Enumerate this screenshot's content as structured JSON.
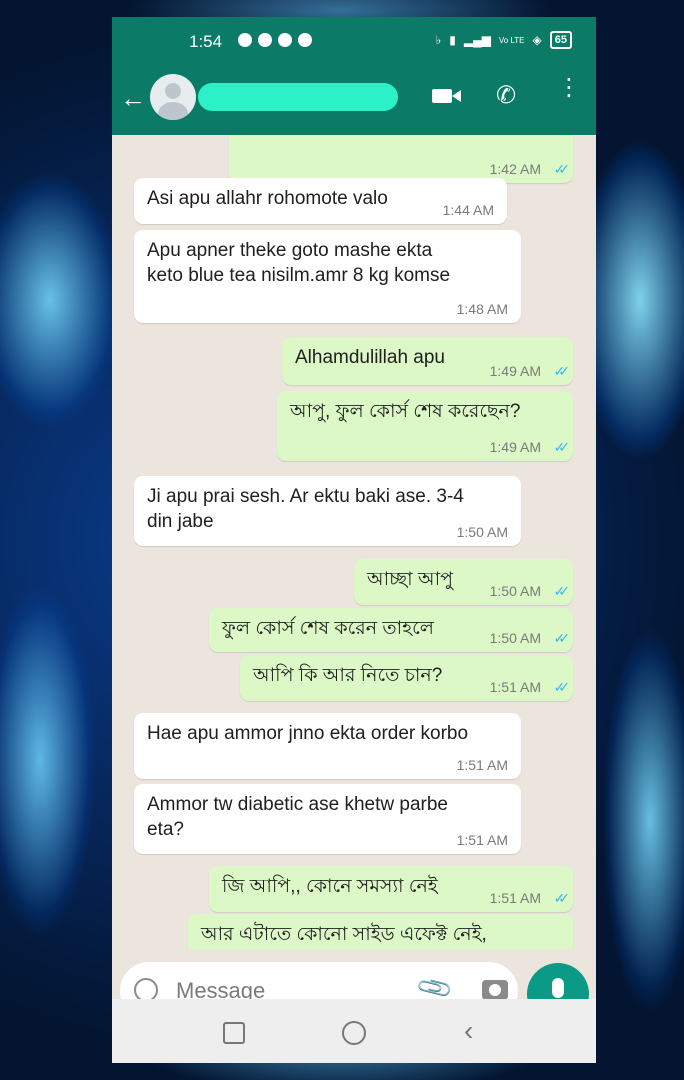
{
  "status_bar": {
    "time": "1:54",
    "battery": "65",
    "signal_text": "Vo LTE"
  },
  "header": {
    "contact_name": "Contact name (redacted)",
    "back_icon": "back-arrow-icon",
    "video_icon": "video-camera-icon",
    "call_icon": "phone-icon",
    "menu_icon": "more-vertical-icon"
  },
  "messages": [
    {
      "dir": "out",
      "text": "",
      "time": "1:42 AM"
    },
    {
      "dir": "in",
      "text": "Asi apu allahr rohomote valo",
      "time": "1:44 AM"
    },
    {
      "dir": "in",
      "text": "Apu apner theke goto mashe ekta\nketo blue tea nisilm.amr 8 kg komse",
      "time": "1:48 AM"
    },
    {
      "dir": "out",
      "text": "Alhamdulillah apu",
      "time": "1:49 AM"
    },
    {
      "dir": "out",
      "text": "আপু, ফুল কোর্স শেষ করেছেন?",
      "time": "1:49 AM"
    },
    {
      "dir": "in",
      "text": "Ji apu prai sesh. Ar ektu baki ase. 3-4\ndin jabe",
      "time": "1:50 AM"
    },
    {
      "dir": "out",
      "text": "আচ্ছা আপু",
      "time": "1:50 AM"
    },
    {
      "dir": "out",
      "text": "ফুল কোর্স শেষ করেন তাহলে",
      "time": "1:50 AM"
    },
    {
      "dir": "out",
      "text": "আপি কি আর নিতে চান?",
      "time": "1:51 AM"
    },
    {
      "dir": "in",
      "text": "Hae apu ammor jnno ekta order korbo",
      "time": "1:51 AM"
    },
    {
      "dir": "in",
      "text": "Ammor tw diabetic ase khetw parbe\neta?",
      "time": "1:51 AM"
    },
    {
      "dir": "out",
      "text": "জি আপি,, কোনে সমস্যা নেই",
      "time": "1:51 AM"
    },
    {
      "dir": "out",
      "text": "আর এটাতে কোনো সাইড এফেক্ট নেই,",
      "time": ""
    }
  ],
  "composer": {
    "placeholder": "Message"
  },
  "colors": {
    "header": "#0b7a67",
    "outgoing_bubble": "#dcf8c6",
    "incoming_bubble": "#ffffff",
    "read_ticks": "#34b7f1",
    "mic_button": "#0b9a85"
  }
}
